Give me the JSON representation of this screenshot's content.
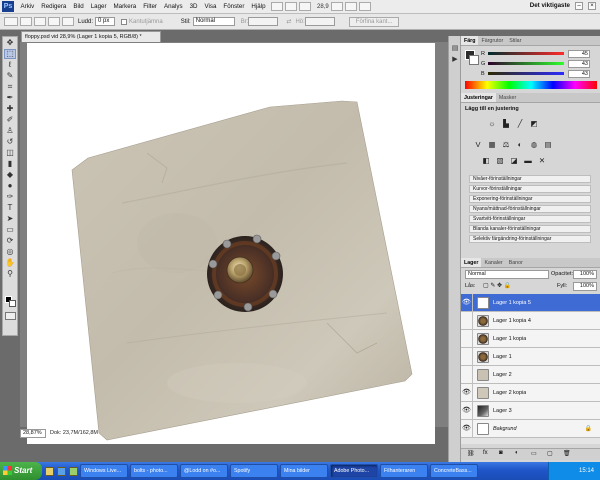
{
  "menubar": {
    "items": [
      "Arkiv",
      "Redigera",
      "Bild",
      "Lager",
      "Markera",
      "Filter",
      "Analys",
      "3D",
      "Visa",
      "Fönster",
      "Hjälp"
    ],
    "zoom": "28,9",
    "workspace": "Det viktigaste"
  },
  "options": {
    "feather_label": "Ludd:",
    "feather_value": "0 px",
    "antialias_label": "Kantutjämna",
    "style_label": "Stil:",
    "style_value": "Normal",
    "width_label": "Br:",
    "height_label": "Hö:",
    "refine_label": "Förfina kant..."
  },
  "document": {
    "tab_title": "floppy.psd vid 28,9% (Lager 1 kopia 5, RGB/8) *",
    "zoom_status": "28,87%",
    "doc_status": "Dok: 23,7M/162,8M"
  },
  "color_panel": {
    "tabs": [
      "Färg",
      "Färgrutor",
      "Stilar"
    ],
    "channels": [
      {
        "label": "R",
        "value": "45"
      },
      {
        "label": "G",
        "value": "43"
      },
      {
        "label": "B",
        "value": "43"
      }
    ]
  },
  "adjust_panel": {
    "tabs": [
      "Justeringar",
      "Masker"
    ],
    "title": "Lägg till en justering",
    "icons": [
      "brightness-icon",
      "levels-icon",
      "curves-icon",
      "exposure-icon",
      "vibrance-icon",
      "hue-icon",
      "balance-icon",
      "bw-icon",
      "photo-filter-icon",
      "channel-mixer-icon",
      "invert-icon",
      "posterize-icon",
      "threshold-icon",
      "gradient-map-icon",
      "selective-color-icon"
    ],
    "icon_glyphs": [
      "☼",
      "▙",
      "╱",
      "◩",
      "V",
      "▦",
      "⚖",
      "◐",
      "◍",
      "▤",
      "◧",
      "▧",
      "◪",
      "▬",
      "✕"
    ],
    "presets": [
      "Nivåer-förinställningar",
      "Kurvor-förinställningar",
      "Exponering-förinställningar",
      "Nyans/mättnad-förinställningar",
      "Svartvitt-förinställningar",
      "Blanda kanaler-förinställningar",
      "Selektiv färgändring-förinställningar"
    ]
  },
  "layers_panel": {
    "tabs": [
      "Lager",
      "Kanaler",
      "Banor"
    ],
    "blend_mode": "Normal",
    "opacity_label": "Opacitet:",
    "opacity_value": "100%",
    "lock_label": "Lås:",
    "fill_label": "Fyll:",
    "fill_value": "100%",
    "layers": [
      {
        "name": "Lager 1 kopia 5",
        "visible": true,
        "active": true,
        "thumb": "blank"
      },
      {
        "name": "Lager 1 kopia 4",
        "visible": false,
        "active": false,
        "thumb": "hub"
      },
      {
        "name": "Lager 1 kopia",
        "visible": false,
        "active": false,
        "thumb": "hub"
      },
      {
        "name": "Lager 1",
        "visible": false,
        "active": false,
        "thumb": "hub"
      },
      {
        "name": "Lager 2",
        "visible": false,
        "active": false,
        "thumb": "stone"
      },
      {
        "name": "Lager 2 kopia",
        "visible": true,
        "active": false,
        "thumb": "stone"
      },
      {
        "name": "Lager 3",
        "visible": true,
        "active": false,
        "thumb": "dark"
      },
      {
        "name": "Bakgrund",
        "visible": true,
        "active": false,
        "thumb": "white",
        "locked": true
      }
    ]
  },
  "taskbar": {
    "start_label": "Start",
    "tasks": [
      "Windows Live...",
      "bolts - photo...",
      "@Lodd on #o...",
      "Spotify",
      "Mina bilder",
      "Adobe Photo...",
      "Filhanteraren",
      "ConcreteBass..."
    ],
    "active_task": "Adobe Photo...",
    "clock": "15:14"
  },
  "colors": {
    "selection": "#3f6bd5",
    "taskbar": "#2458d0",
    "start": "#3a9a3a"
  }
}
